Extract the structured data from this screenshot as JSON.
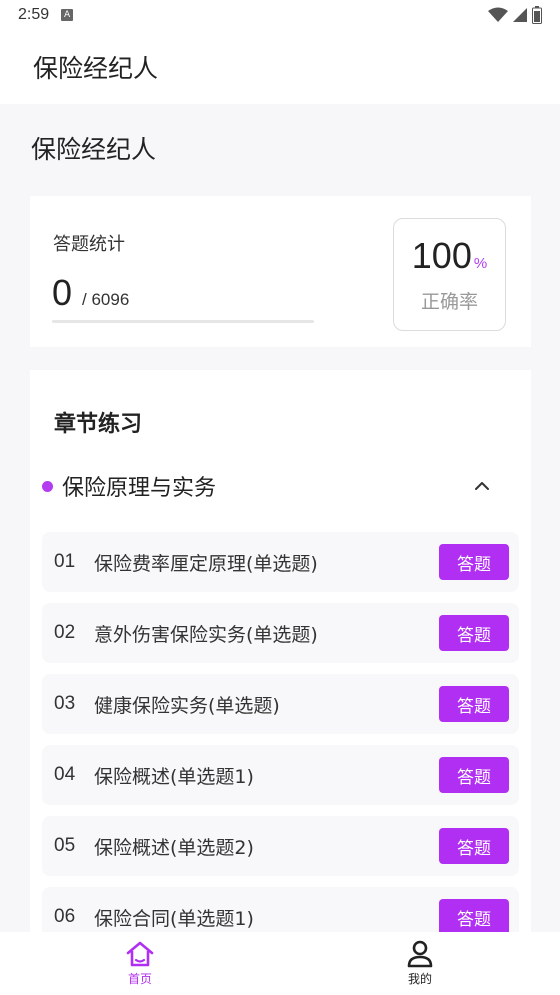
{
  "status_bar": {
    "time": "2:59",
    "notification_letter": "A"
  },
  "app_bar": {
    "title": "保险经纪人"
  },
  "page": {
    "title": "保险经纪人"
  },
  "stats": {
    "label": "答题统计",
    "answered": "0",
    "total": "/ 6096",
    "progress_fraction": 0,
    "accuracy_value": "100",
    "accuracy_unit": "%",
    "accuracy_label": "正确率"
  },
  "chapters": {
    "heading": "章节练习",
    "group_title": "保险原理与实务",
    "lessons": [
      {
        "num": "01",
        "title": "保险费率厘定原理(单选题)",
        "button": "答题"
      },
      {
        "num": "02",
        "title": "意外伤害保险实务(单选题)",
        "button": "答题"
      },
      {
        "num": "03",
        "title": "健康保险实务(单选题)",
        "button": "答题"
      },
      {
        "num": "04",
        "title": "保险概述(单选题1)",
        "button": "答题"
      },
      {
        "num": "05",
        "title": "保险概述(单选题2)",
        "button": "答题"
      },
      {
        "num": "06",
        "title": "保险合同(单选题1)",
        "button": "答题"
      }
    ]
  },
  "bottom_nav": {
    "items": [
      {
        "label": "首页",
        "icon": "home-icon",
        "active": true
      },
      {
        "label": "我的",
        "icon": "user-icon",
        "active": false
      }
    ]
  },
  "colors": {
    "accent": "#b12ff2",
    "background": "#f7f7fa"
  }
}
